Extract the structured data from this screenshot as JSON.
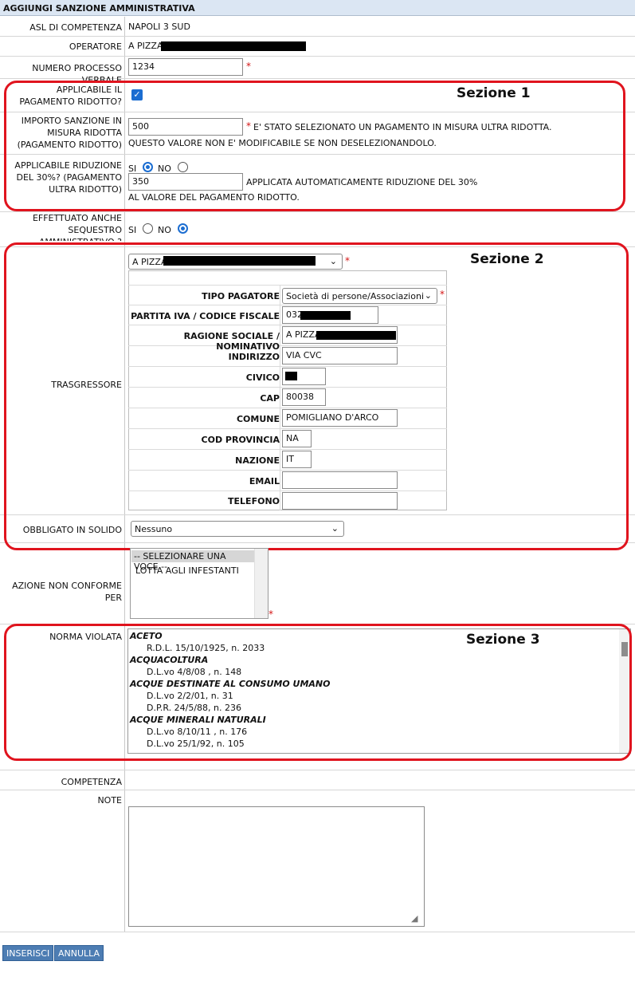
{
  "form_title": "AGGIUNGI SANZIONE AMMINISTRATIVA",
  "asl": {
    "label": "ASL DI COMPETENZA",
    "value": "NAPOLI 3 SUD"
  },
  "operatore": {
    "label": "OPERATORE",
    "value": "A PIZZA"
  },
  "numero_processo": {
    "label": "NUMERO PROCESSO VERBALE",
    "value": "1234"
  },
  "sezione1": {
    "annotation": "Sezione 1",
    "pagamento_ridotto": {
      "label": "APPLICABILE IL PAGAMENTO RIDOTTO?",
      "checked": true
    },
    "importo": {
      "label": "IMPORTO SANZIONE IN MISURA RIDOTTA (PAGAMENTO RIDOTTO)",
      "value": "500",
      "note1": "E' STATO SELEZIONATO UN PAGAMENTO IN MISURA ULTRA RIDOTTA.",
      "note2": "QUESTO VALORE NON E' MODIFICABILE SE NON DESELEZIONANDOLO."
    },
    "riduzione": {
      "label": "APPLICABILE RIDUZIONE DEL 30%? (PAGAMENTO ULTRA RIDOTTO)",
      "si": "SI",
      "no": "NO",
      "selected": "SI",
      "value": "350",
      "note1": "APPLICATA AUTOMATICAMENTE RIDUZIONE DEL 30%",
      "note2": "AL VALORE DEL PAGAMENTO RIDOTTO."
    }
  },
  "sequestro": {
    "label": "EFFETTUATO ANCHE SEQUESTRO AMMINISTRATIVO ?",
    "si": "SI",
    "no": "NO",
    "selected": "NO"
  },
  "sezione2": {
    "annotation": "Sezione 2",
    "trasgressore_label": "TRASGRESSORE",
    "trasgressore_select": "A PIZZA",
    "fields": {
      "tipo_pagatore": {
        "label": "TIPO PAGATORE",
        "value": "Società di persone/Associazioni"
      },
      "piva": {
        "label": "PARTITA IVA / CODICE FISCALE",
        "value": "032"
      },
      "ragione": {
        "label": "RAGIONE SOCIALE / NOMINATIVO",
        "value": "A PIZZA"
      },
      "indirizzo": {
        "label": "INDIRIZZO",
        "value": "VIA CVC"
      },
      "civico": {
        "label": "CIVICO",
        "value": ""
      },
      "cap": {
        "label": "CAP",
        "value": "80038"
      },
      "comune": {
        "label": "COMUNE",
        "value": "POMIGLIANO D'ARCO"
      },
      "cod_provincia": {
        "label": "COD PROVINCIA",
        "value": "NA"
      },
      "nazione": {
        "label": "NAZIONE",
        "value": "IT"
      },
      "email": {
        "label": "EMAIL",
        "value": ""
      },
      "telefono": {
        "label": "TELEFONO",
        "value": ""
      }
    },
    "obbligato": {
      "label": "OBBLIGATO IN SOLIDO",
      "value": "Nessuno"
    }
  },
  "azione": {
    "label": "AZIONE NON CONFORME PER",
    "options": [
      "-- SELEZIONARE UNA VOCE --",
      "LOTTA AGLI INFESTANTI"
    ],
    "selected": "-- SELEZIONARE UNA VOCE --"
  },
  "sezione3": {
    "annotation": "Sezione 3",
    "label": "NORMA VIOLATA",
    "items": [
      {
        "kind": "cat",
        "text": "ACETO"
      },
      {
        "kind": "law",
        "text": "R.D.L. 15/10/1925, n. 2033"
      },
      {
        "kind": "cat",
        "text": "ACQUACOLTURA"
      },
      {
        "kind": "law",
        "text": "D.L.vo 4/8/08 , n. 148"
      },
      {
        "kind": "cat",
        "text": "ACQUE DESTINATE AL CONSUMO UMANO"
      },
      {
        "kind": "law",
        "text": "D.L.vo 2/2/01, n. 31"
      },
      {
        "kind": "law",
        "text": "D.P.R. 24/5/88, n. 236"
      },
      {
        "kind": "cat",
        "text": "ACQUE MINERALI NATURALI"
      },
      {
        "kind": "law",
        "text": "D.L.vo 8/10/11 , n. 176"
      },
      {
        "kind": "law",
        "text": "D.L.vo 25/1/92, n. 105"
      }
    ]
  },
  "competenza": {
    "label": "COMPETENZA"
  },
  "note": {
    "label": "NOTE",
    "value": ""
  },
  "buttons": {
    "inserisci": "INSERISCI",
    "annulla": "ANNULLA"
  },
  "colors": {
    "header_bg": "#dbe6f3",
    "annotation_red": "#e0141e",
    "accent_blue": "#1b6dd1",
    "button_blue": "#4d7db3"
  }
}
